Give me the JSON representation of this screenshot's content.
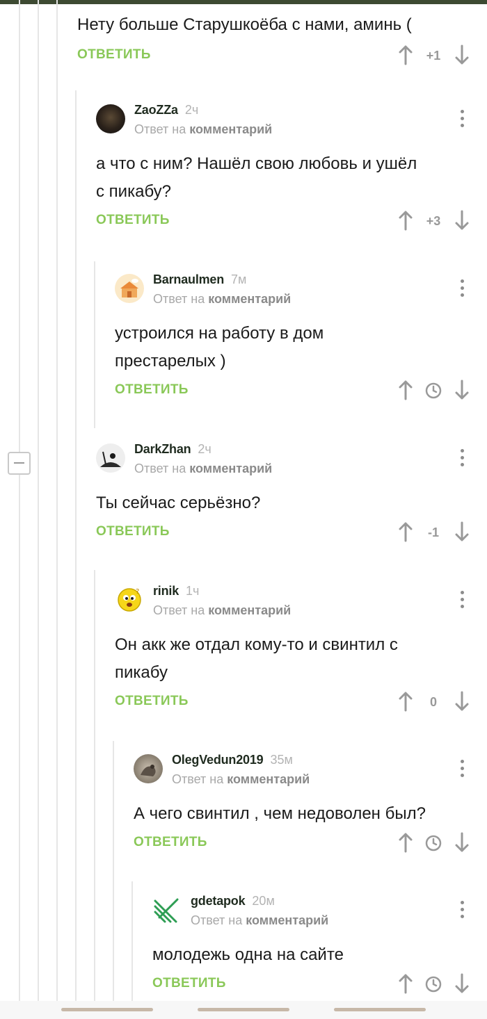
{
  "top_comment": {
    "text": "Нету больше Старушкоёба с нами, аминь (",
    "reply_label": "ОТВЕТИТЬ",
    "rating": "+1"
  },
  "comments": [
    {
      "username": "ZaoZZa",
      "time": "2ч",
      "reply_prefix": "Ответ на",
      "reply_target": "комментарий",
      "text_lines": [
        "а что с ним? Нашёл свою любовь и ушёл",
        "с пикабу?"
      ],
      "reply_label": "ОТВЕТИТЬ",
      "rating": "+3"
    },
    {
      "username": "Barnaulmen",
      "time": "7м",
      "reply_prefix": "Ответ на",
      "reply_target": "комментарий",
      "text_lines": [
        "устроился на работу в дом",
        "престарелых )"
      ],
      "reply_label": "ОТВЕТИТЬ",
      "rating_icon": "clock-icon"
    },
    {
      "username": "DarkZhan",
      "time": "2ч",
      "reply_prefix": "Ответ на",
      "reply_target": "комментарий",
      "text_lines": [
        "Ты сейчас серьёзно?"
      ],
      "reply_label": "ОТВЕТИТЬ",
      "rating": "-1"
    },
    {
      "username": "rinik",
      "time": "1ч",
      "reply_prefix": "Ответ на",
      "reply_target": "комментарий",
      "text_lines": [
        "Он акк же отдал кому-то и свинтил с",
        "пикабу"
      ],
      "reply_label": "ОТВЕТИТЬ",
      "rating": "0"
    },
    {
      "username": "OlegVedun2019",
      "time": "35м",
      "reply_prefix": "Ответ на",
      "reply_target": "комментарий",
      "text_lines": [
        "А чего свинтил , чем недоволен был?"
      ],
      "reply_label": "ОТВЕТИТЬ",
      "rating_icon": "clock-icon"
    },
    {
      "username": "gdetapok",
      "time": "20м",
      "reply_prefix": "Ответ на",
      "reply_target": "комментарий",
      "text_lines": [
        "молодежь одна на сайте"
      ],
      "reply_label": "ОТВЕТИТЬ",
      "rating_icon": "clock-icon"
    }
  ],
  "colors": {
    "accent_green": "#8ac858",
    "username": "#1f2b1f",
    "muted": "#a8a8a8",
    "topbar": "#3d4a32"
  },
  "icons": [
    "arrow-up-icon",
    "arrow-down-icon",
    "clock-icon",
    "more-vertical-icon",
    "collapse-icon"
  ]
}
